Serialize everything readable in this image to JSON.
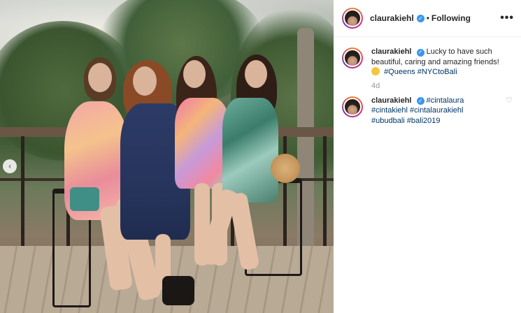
{
  "header": {
    "username": "claurakiehl",
    "separator": "•",
    "follow_status": "Following",
    "more_label": "•••"
  },
  "caption": {
    "username": "claurakiehl",
    "text": "Lucky to have such beautiful, caring and amazing friends!",
    "hashtags": [
      "#Queens",
      "#NYCtoBali"
    ],
    "timestamp": "4d"
  },
  "comment": {
    "username": "claurakiehl",
    "hashtags": [
      "#cintalaura",
      "#cintakiehl",
      "#cintalaurakiehl",
      "#ubudbali",
      "#bali2019"
    ]
  },
  "icons": {
    "carousel_prev": "chevron-left-icon",
    "verified": "verified-badge-icon",
    "like": "heart-icon"
  },
  "colors": {
    "verified": "#3897f0",
    "hashtag": "#003569",
    "muted": "#999999"
  }
}
